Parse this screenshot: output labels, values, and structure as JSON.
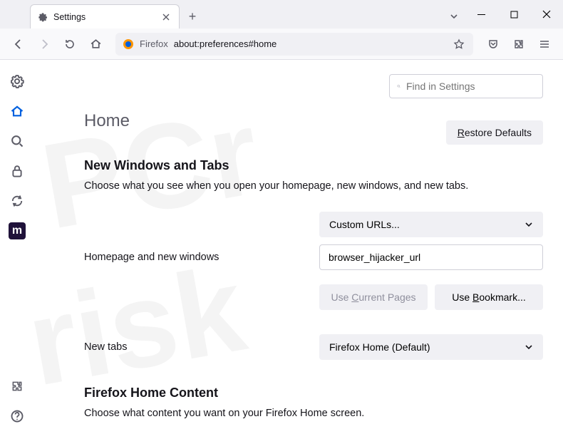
{
  "tab": {
    "title": "Settings"
  },
  "url": {
    "label": "Firefox",
    "text": "about:preferences#home"
  },
  "find": {
    "placeholder": "Find in Settings"
  },
  "page": {
    "heading": "Home",
    "restore": "Restore Defaults",
    "section1_title": "New Windows and Tabs",
    "section1_desc": "Choose what you see when you open your homepage, new windows, and new tabs.",
    "homepage_label": "Homepage and new windows",
    "homepage_dropdown": "Custom URLs...",
    "homepage_value": "browser_hijacker_url",
    "use_current": "Use Current Pages",
    "use_bookmark": "Use Bookmark...",
    "newtabs_label": "New tabs",
    "newtabs_dropdown": "Firefox Home (Default)",
    "section2_title": "Firefox Home Content",
    "section2_desc": "Choose what content you want on your Firefox Home screen."
  }
}
